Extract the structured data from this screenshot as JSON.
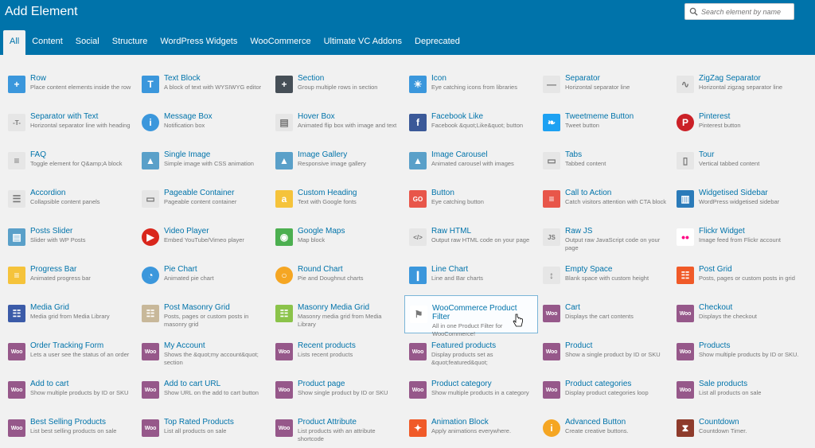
{
  "header": {
    "title": "Add Element"
  },
  "search": {
    "placeholder": "Search element by name"
  },
  "tabs": [
    "All",
    "Content",
    "Social",
    "Structure",
    "WordPress Widgets",
    "WooCommerce",
    "Ultimate VC Addons",
    "Deprecated"
  ],
  "active_tab": "All",
  "elements": [
    {
      "name": "Row",
      "desc": "Place content elements inside the row",
      "icon": "plus-icon",
      "color": "#3b97dc"
    },
    {
      "name": "Text Block",
      "desc": "A block of text with WYSIWYG editor",
      "icon": "text-t-icon",
      "color": "#3b97dc"
    },
    {
      "name": "Section",
      "desc": "Group multiple rows in section",
      "icon": "plus-dark-icon",
      "color": "#464f57"
    },
    {
      "name": "Icon",
      "desc": "Eye catching icons from libraries",
      "icon": "sun-icon",
      "color": "#3b97dc"
    },
    {
      "name": "Separator",
      "desc": "Horizontal separator line",
      "icon": "separator-icon",
      "color": "#e6e6e6"
    },
    {
      "name": "ZigZag Separator",
      "desc": "Horizontal zigzag separator line",
      "icon": "zigzag-icon",
      "color": "#e6e6e6"
    },
    {
      "name": "Separator with Text",
      "desc": "Horizontal separator line with heading",
      "icon": "separator-text-icon",
      "color": "#e6e6e6"
    },
    {
      "name": "Message Box",
      "desc": "Notification box",
      "icon": "info-icon",
      "color": "#3b97dc"
    },
    {
      "name": "Hover Box",
      "desc": "Animated flip box with image and text",
      "icon": "hover-box-icon",
      "color": "#e6e6e6"
    },
    {
      "name": "Facebook Like",
      "desc": "Facebook &quot;Like&quot; button",
      "icon": "facebook-icon",
      "color": "#3b5998"
    },
    {
      "name": "Tweetmeme Button",
      "desc": "Tweet button",
      "icon": "twitter-icon",
      "color": "#1da1f2"
    },
    {
      "name": "Pinterest",
      "desc": "Pinterest button",
      "icon": "pinterest-icon",
      "color": "#cb2027"
    },
    {
      "name": "FAQ",
      "desc": "Toggle element for Q&amp;A block",
      "icon": "faq-icon",
      "color": "#e6e6e6"
    },
    {
      "name": "Single Image",
      "desc": "Simple image with CSS animation",
      "icon": "image-icon",
      "color": "#5aa0c9"
    },
    {
      "name": "Image Gallery",
      "desc": "Responsive image gallery",
      "icon": "gallery-icon",
      "color": "#5aa0c9"
    },
    {
      "name": "Image Carousel",
      "desc": "Animated carousel with images",
      "icon": "carousel-icon",
      "color": "#5aa0c9"
    },
    {
      "name": "Tabs",
      "desc": "Tabbed content",
      "icon": "tabs-icon",
      "color": "#e6e6e6"
    },
    {
      "name": "Tour",
      "desc": "Vertical tabbed content",
      "icon": "tour-icon",
      "color": "#e6e6e6"
    },
    {
      "name": "Accordion",
      "desc": "Collapsible content panels",
      "icon": "accordion-icon",
      "color": "#e6e6e6"
    },
    {
      "name": "Pageable Container",
      "desc": "Pageable content container",
      "icon": "pageable-icon",
      "color": "#e6e6e6"
    },
    {
      "name": "Custom Heading",
      "desc": "Text with Google fonts",
      "icon": "heading-a-icon",
      "color": "#f5c33b"
    },
    {
      "name": "Button",
      "desc": "Eye catching button",
      "icon": "go-button-icon",
      "color": "#e8564a"
    },
    {
      "name": "Call to Action",
      "desc": "Catch visitors attention with CTA block",
      "icon": "cta-icon",
      "color": "#e8564a"
    },
    {
      "name": "Widgetised Sidebar",
      "desc": "WordPress widgetised sidebar",
      "icon": "sidebar-icon",
      "color": "#2b7bb9"
    },
    {
      "name": "Posts Slider",
      "desc": "Slider with WP Posts",
      "icon": "slider-icon",
      "color": "#5aa0c9"
    },
    {
      "name": "Video Player",
      "desc": "Embed YouTube/Vimeo player",
      "icon": "play-icon",
      "color": "#d9261c"
    },
    {
      "name": "Google Maps",
      "desc": "Map block",
      "icon": "map-pin-icon",
      "color": "#4caf50"
    },
    {
      "name": "Raw HTML",
      "desc": "Output raw HTML code on your page",
      "icon": "html-icon",
      "color": "#e6e6e6"
    },
    {
      "name": "Raw JS",
      "desc": "Output raw JavaScript code on your page",
      "icon": "js-icon",
      "color": "#e6e6e6"
    },
    {
      "name": "Flickr Widget",
      "desc": "Image feed from Flickr account",
      "icon": "flickr-icon",
      "color": "#ffffff"
    },
    {
      "name": "Progress Bar",
      "desc": "Animated progress bar",
      "icon": "progress-icon",
      "color": "#f5c33b"
    },
    {
      "name": "Pie Chart",
      "desc": "Animated pie chart",
      "icon": "pie-icon",
      "color": "#3b97dc"
    },
    {
      "name": "Round Chart",
      "desc": "Pie and Doughnut charts",
      "icon": "donut-icon",
      "color": "#f5a623"
    },
    {
      "name": "Line Chart",
      "desc": "Line and Bar charts",
      "icon": "bar-chart-icon",
      "color": "#3b97dc"
    },
    {
      "name": "Empty Space",
      "desc": "Blank space with custom height",
      "icon": "empty-space-icon",
      "color": "#e6e6e6"
    },
    {
      "name": "Post Grid",
      "desc": "Posts, pages or custom posts in grid",
      "icon": "grid-icon",
      "color": "#f05a28"
    },
    {
      "name": "Media Grid",
      "desc": "Media grid from Media Library",
      "icon": "media-grid-icon",
      "color": "#3b5ba8"
    },
    {
      "name": "Post Masonry Grid",
      "desc": "Posts, pages or custom posts in masonry grid",
      "icon": "masonry-icon",
      "color": "#c8b89a"
    },
    {
      "name": "Masonry Media Grid",
      "desc": "Masonry media grid from Media Library",
      "icon": "masonry-media-icon",
      "color": "#8bc34a"
    },
    {
      "name": "WooCommerce Product Filter",
      "desc": "All in one Product Filter for WooCommerce!",
      "icon": "product-filter-icon",
      "color": "#ffffff"
    },
    {
      "name": "Cart",
      "desc": "Displays the cart contents",
      "icon": "woo-icon",
      "color": "#96588a"
    },
    {
      "name": "Checkout",
      "desc": "Displays the checkout",
      "icon": "woo-icon",
      "color": "#96588a"
    },
    {
      "name": "Order Tracking Form",
      "desc": "Lets a user see the status of an order",
      "icon": "woo-icon",
      "color": "#96588a"
    },
    {
      "name": "My Account",
      "desc": "Shows the &quot;my account&quot; section",
      "icon": "woo-icon",
      "color": "#96588a"
    },
    {
      "name": "Recent products",
      "desc": "Lists recent products",
      "icon": "woo-icon",
      "color": "#96588a"
    },
    {
      "name": "Featured products",
      "desc": "Display products set as &quot;featured&quot;",
      "icon": "woo-icon",
      "color": "#96588a"
    },
    {
      "name": "Product",
      "desc": "Show a single product by ID or SKU",
      "icon": "woo-icon",
      "color": "#96588a"
    },
    {
      "name": "Products",
      "desc": "Show multiple products by ID or SKU.",
      "icon": "woo-icon",
      "color": "#96588a"
    },
    {
      "name": "Add to cart",
      "desc": "Show multiple products by ID or SKU",
      "icon": "woo-icon",
      "color": "#96588a"
    },
    {
      "name": "Add to cart URL",
      "desc": "Show URL on the add to cart button",
      "icon": "woo-icon",
      "color": "#96588a"
    },
    {
      "name": "Product page",
      "desc": "Show single product by ID or SKU",
      "icon": "woo-icon",
      "color": "#96588a"
    },
    {
      "name": "Product category",
      "desc": "Show multiple products in a category",
      "icon": "woo-icon",
      "color": "#96588a"
    },
    {
      "name": "Product categories",
      "desc": "Display product categories loop",
      "icon": "woo-icon",
      "color": "#96588a"
    },
    {
      "name": "Sale products",
      "desc": "List all products on sale",
      "icon": "woo-icon",
      "color": "#96588a"
    },
    {
      "name": "Best Selling Products",
      "desc": "List best selling products on sale",
      "icon": "woo-icon",
      "color": "#96588a"
    },
    {
      "name": "Top Rated Products",
      "desc": "List all products on sale",
      "icon": "woo-icon",
      "color": "#96588a"
    },
    {
      "name": "Product Attribute",
      "desc": "List products with an attribute shortcode",
      "icon": "woo-icon",
      "color": "#96588a"
    },
    {
      "name": "Animation Block",
      "desc": "Apply animations everywhere.",
      "icon": "magic-wand-icon",
      "color": "#f05a28"
    },
    {
      "name": "Advanced Button",
      "desc": "Create creative buttons.",
      "icon": "info-circle-icon",
      "color": "#f5a623"
    },
    {
      "name": "Countdown",
      "desc": "Countdown Timer.",
      "icon": "hourglass-icon",
      "color": "#8e3b2b"
    }
  ],
  "woo_label": "Woo",
  "highlighted_element": "WooCommerce Product Filter"
}
